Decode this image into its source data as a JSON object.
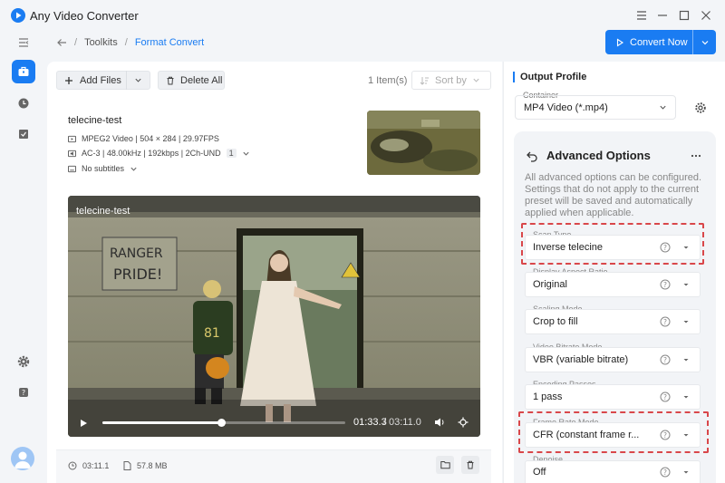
{
  "window": {
    "title": "Any Video Converter"
  },
  "breadcrumb": {
    "parent": "Toolkits",
    "separator": "/",
    "current": "Format Convert"
  },
  "toolbar": {
    "convert_now": "Convert Now",
    "add_files": "Add Files",
    "delete_all": "Delete All",
    "items_count": "1 Item(s)",
    "sort_by": "Sort by"
  },
  "file": {
    "name": "telecine-test",
    "video_info": "MPEG2 Video | 504 × 284 | 29.97FPS",
    "audio_info": "AC-3 | 48.00kHz | 192kbps | 2Ch-UND",
    "audio_track_count": "1",
    "subtitles": "No subtitles"
  },
  "player": {
    "title": "telecine-test",
    "current_time": "01:33.3",
    "total_time": "03:11.0",
    "progress": 0.49,
    "time_separator": "/"
  },
  "footer": {
    "duration": "03:11.1",
    "size": "57.8 MB"
  },
  "output_profile": {
    "title": "Output Profile",
    "container_label": "Container",
    "container_value": "MP4 Video (*.mp4)"
  },
  "advanced": {
    "title": "Advanced Options",
    "description": "All advanced options can be configured. Settings that do not apply to the current preset will be saved and automatically applied when applicable.",
    "options": [
      {
        "label": "Scan Type",
        "value": "Inverse telecine"
      },
      {
        "label": "Display Aspect Ratio",
        "value": "Original"
      },
      {
        "label": "Scaling Mode",
        "value": "Crop to fill"
      },
      {
        "label": "Video Bitrate Mode",
        "value": "VBR (variable bitrate)"
      },
      {
        "label": "Encoding Passes",
        "value": "1 pass"
      },
      {
        "label": "Frame Rate Mode",
        "value": "CFR (constant frame r..."
      },
      {
        "label": "Denoise",
        "value": "Off"
      }
    ]
  },
  "colors": {
    "accent": "#1a7cf2",
    "highlight": "#d9474a"
  },
  "icons": [
    "menu-icon",
    "toolbox-icon",
    "clock-icon",
    "task-icon",
    "settings-icon",
    "help-icon",
    "back-arrow-icon",
    "play-icon",
    "volume-icon",
    "fullscreen-icon",
    "folder-icon",
    "trash-icon"
  ]
}
